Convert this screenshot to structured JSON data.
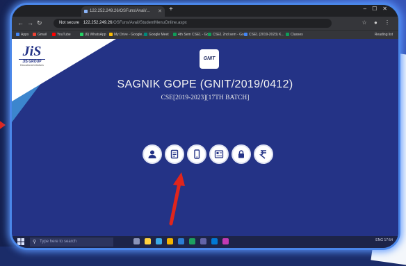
{
  "browser": {
    "tab_title": "122.252.249.26/OSFuns/Avail/...",
    "url_secure_label": "Not secure",
    "url_host": "122.252.249.26",
    "url_path": "/OSFuns/Avail/StudentMenuOnline.aspx",
    "bookmarks": [
      {
        "label": "Apps",
        "color": "#4285f4"
      },
      {
        "label": "Gmail",
        "color": "#ea4335"
      },
      {
        "label": "YouTube",
        "color": "#ff0000"
      },
      {
        "label": "(6) WhatsApp",
        "color": "#25d366"
      },
      {
        "label": "My Drive - Google...",
        "color": "#fbbc04"
      },
      {
        "label": "Google Meet",
        "color": "#00897b"
      },
      {
        "label": "4th Sem CSE1 - Go...",
        "color": "#0f9d58"
      },
      {
        "label": "CSE1 2nd sem - Go...",
        "color": "#0f9d58"
      },
      {
        "label": "CSE1 (2019-2023) K...",
        "color": "#4285f4"
      },
      {
        "label": "Classes",
        "color": "#0f9d58"
      }
    ],
    "reading_list": "Reading list"
  },
  "page": {
    "jis_mark": "JiS",
    "jis_group": "JIS GROUP",
    "jis_tagline": "Educational Initiatives",
    "gnit_logo": "GNIT",
    "student_name": "SAGNIK GOPE (GNIT/2019/0412)",
    "student_batch": "CSE[2019-2023][17TH BATCH]"
  },
  "menu_icons": [
    {
      "name": "profile-icon"
    },
    {
      "name": "document-icon"
    },
    {
      "name": "phone-icon"
    },
    {
      "name": "id-card-icon"
    },
    {
      "name": "lock-icon"
    },
    {
      "name": "payment-icon"
    }
  ],
  "taskbar": {
    "search_placeholder": "Type here to search",
    "tray_text": "ENG  17:54"
  },
  "colors": {
    "page_background": "#243386",
    "arrow": "#e0251c",
    "frame_glow": "#4a86e8"
  }
}
